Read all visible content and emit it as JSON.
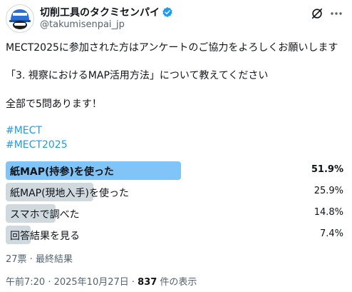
{
  "header": {
    "display_name": "切削工具のタクミセンパイ",
    "handle": "@takumisenpai_jp"
  },
  "post": {
    "lines": [
      "MECT2025に参加された方はアンケートのご協力をよろしくお願いします",
      "「3. 視察におけるMAP活用方法」について教えてください",
      "全部で5問あります！"
    ],
    "hashtags": [
      "#MECT",
      "#MECT2025"
    ]
  },
  "poll": {
    "options": [
      {
        "label": "紙MAP(持参)を使った",
        "percent": "51.9%",
        "fraction": 0.519,
        "winner": true
      },
      {
        "label": "紙MAP(現地入手)を使った",
        "percent": "25.9%",
        "fraction": 0.259,
        "winner": false
      },
      {
        "label": "スマホで調べた",
        "percent": "14.8%",
        "fraction": 0.148,
        "winner": false
      },
      {
        "label": "回答結果を見る",
        "percent": "7.4%",
        "fraction": 0.074,
        "winner": false
      }
    ],
    "summary": "27票 · 最終結果"
  },
  "footer": {
    "timestamp": "午前7:20 · 2025年10月27日 · ",
    "views_count": "837",
    "views_suffix": " 件の表示"
  },
  "colors": {
    "accent": "#1d9bf0",
    "winner_bar": "#80c4f8",
    "bar": "#cfd9de"
  },
  "icons": [
    "avatar-helmet-icon",
    "verified-badge-icon",
    "grok-icon",
    "more-options-icon"
  ]
}
